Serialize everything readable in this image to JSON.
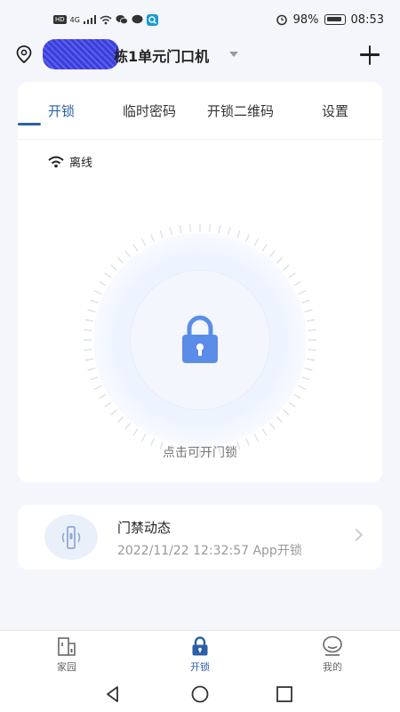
{
  "status_bar": {
    "left_icons": [
      "hd-icon",
      "signal-4g-icon",
      "wifi-icon",
      "wechat-icon",
      "message-icon",
      "app-icon"
    ],
    "net_chip": "HD",
    "net_type": "4G",
    "alarm_icon": "alarm-icon",
    "battery_percent": "98%",
    "time": "08:53"
  },
  "header": {
    "device_title": "栋1单元门口机",
    "add_icon": "plus-icon"
  },
  "tabs": [
    {
      "label": "开锁",
      "active": true
    },
    {
      "label": "临时密码",
      "active": false
    },
    {
      "label": "开锁二维码",
      "active": false
    },
    {
      "label": "设置",
      "active": false
    }
  ],
  "connection": {
    "status": "离线",
    "icon": "wifi-icon"
  },
  "unlock": {
    "icon": "lock-icon",
    "hint": "点击可开门锁",
    "accent": "#5b8de8"
  },
  "activity": {
    "title": "门禁动态",
    "detail": "2022/11/22 12:32:57 App开锁",
    "icon": "door-access-icon"
  },
  "bottom_nav": [
    {
      "label": "家园",
      "icon": "home-building-icon",
      "active": false
    },
    {
      "label": "开锁",
      "icon": "lock-icon",
      "active": true
    },
    {
      "label": "我的",
      "icon": "profile-icon",
      "active": false
    }
  ],
  "system_nav": [
    "back-icon",
    "home-icon",
    "recents-icon"
  ],
  "colors": {
    "accent": "#2d5fa8",
    "background": "#f4f6fb"
  }
}
